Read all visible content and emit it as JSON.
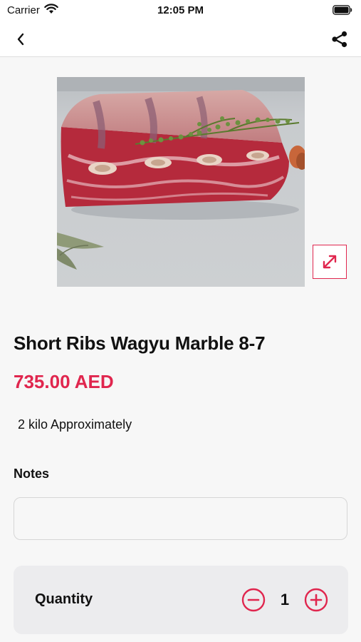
{
  "status_bar": {
    "carrier": "Carrier",
    "time": "12:05 PM"
  },
  "nav": {
    "back_icon": "chevron-left-icon",
    "share_icon": "share-icon"
  },
  "product": {
    "title": "Short Ribs Wagyu Marble 8-7",
    "price": "735.00 AED",
    "description": "2 kilo Approximately",
    "image": "short-ribs-photo",
    "expand_icon": "expand-arrows-icon"
  },
  "notes": {
    "label": "Notes",
    "value": "",
    "placeholder": ""
  },
  "quantity": {
    "label": "Quantity",
    "value": "1",
    "decrease_icon": "minus-circle-icon",
    "increase_icon": "plus-circle-icon"
  },
  "colors": {
    "accent": "#e0264e",
    "background": "#f7f7f7",
    "panel": "#ececee"
  }
}
